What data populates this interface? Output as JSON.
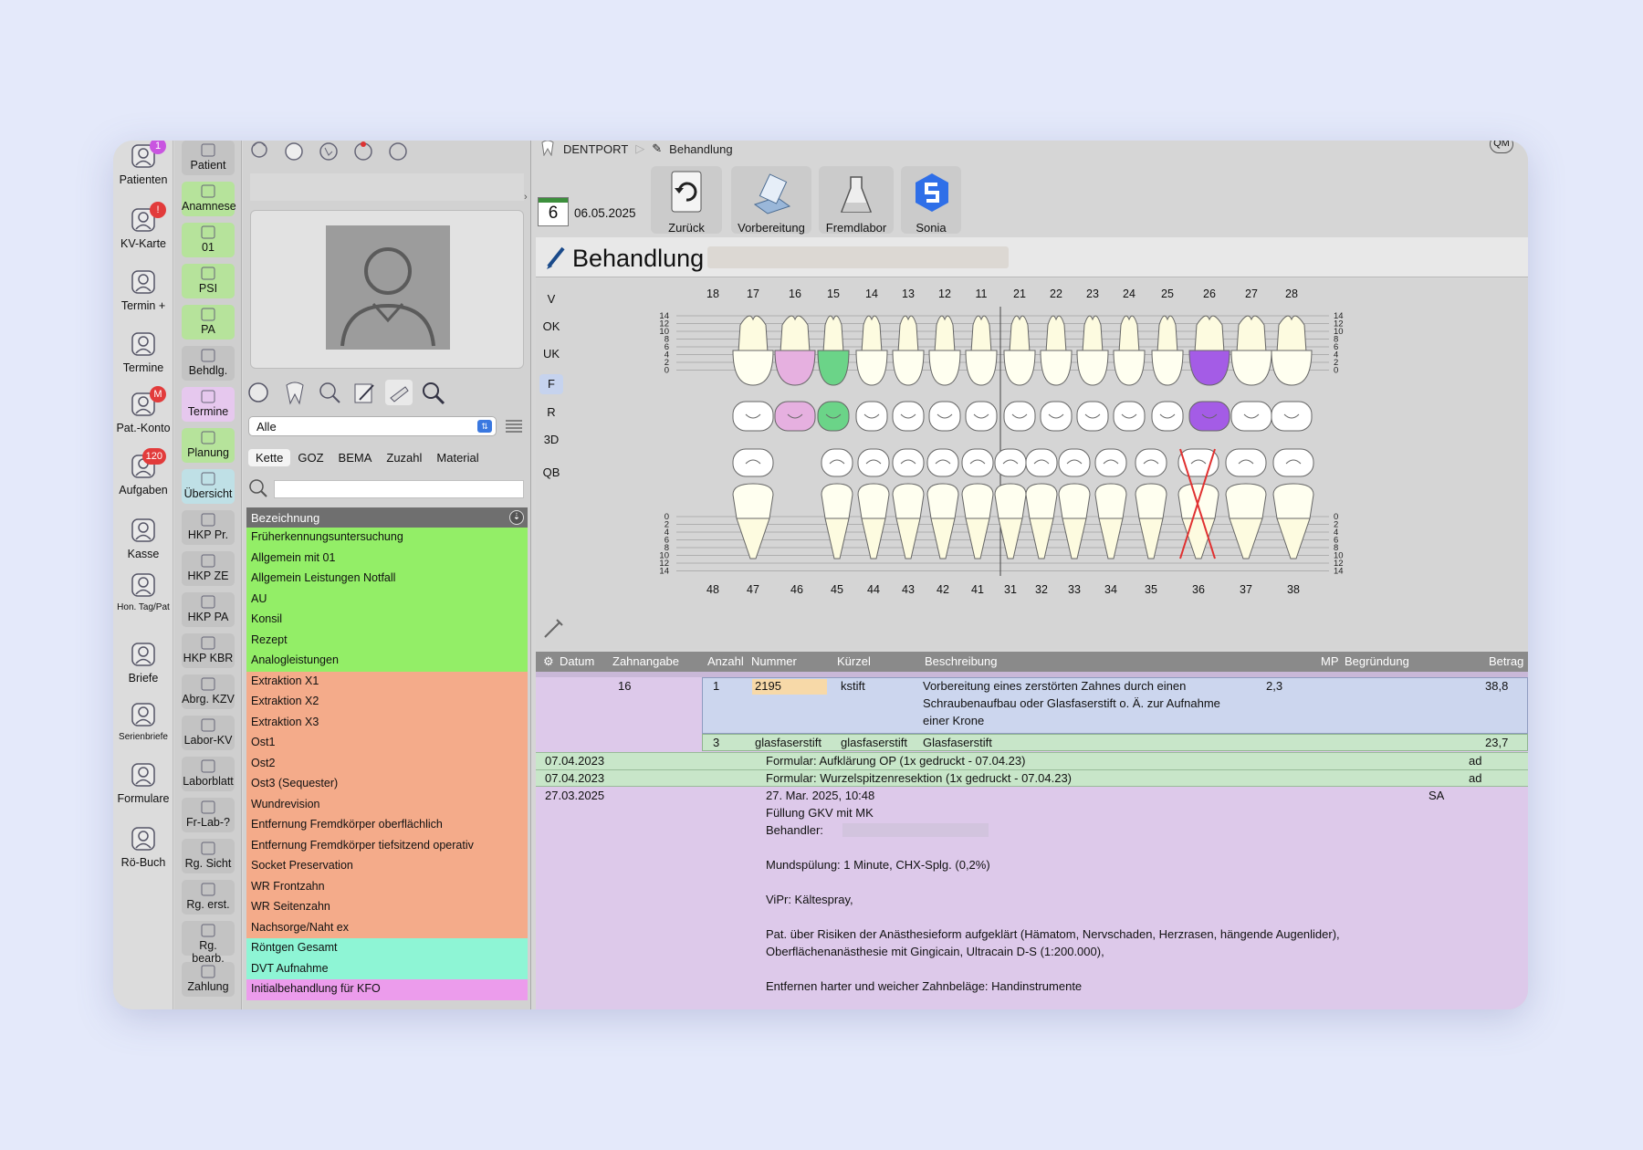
{
  "rail1": [
    {
      "label": "Patienten",
      "icon": "patients-icon",
      "badge": "1",
      "badge_color": "#c955e0"
    },
    {
      "label": "KV-Karte",
      "icon": "insurance-card-icon",
      "badge": "!",
      "badge_color": "#e23b3b"
    },
    {
      "label": "Termin +",
      "icon": "add-appointment-icon"
    },
    {
      "label": "Termine",
      "icon": "appointments-icon"
    },
    {
      "label": "Pat.-Konto",
      "icon": "patient-account-icon",
      "badge": "M",
      "badge_color": "#e23b3b"
    },
    {
      "label": "Aufgaben",
      "icon": "tasks-icon",
      "badge": "120",
      "badge_color": "#e23b3b"
    },
    {
      "label": "Kasse",
      "icon": "cash-icon"
    },
    {
      "label": "Hon. Tag/Pat",
      "icon": "fees-icon"
    },
    {
      "label": "Briefe",
      "icon": "letters-icon"
    },
    {
      "label": "Serienbriefe",
      "icon": "mail-merge-icon"
    },
    {
      "label": "Formulare",
      "icon": "forms-icon"
    },
    {
      "label": "Rö-Buch",
      "icon": "xray-book-icon"
    }
  ],
  "rail2": [
    {
      "label": "Patient",
      "color": "#c3c3c3"
    },
    {
      "label": "Anamnese",
      "color": "#b6e39b"
    },
    {
      "label": "01",
      "color": "#b6e39b"
    },
    {
      "label": "PSI",
      "color": "#b6e39b"
    },
    {
      "label": "PA",
      "color": "#b6e39b"
    },
    {
      "label": "Behdlg.",
      "color": "#c3c3c3"
    },
    {
      "label": "Termine",
      "color": "#e6c8ee"
    },
    {
      "label": "Planung",
      "color": "#b6e39b"
    },
    {
      "label": "Übersicht",
      "color": "#bfe0e6"
    },
    {
      "label": "HKP Pr.",
      "color": "#c3c3c3"
    },
    {
      "label": "HKP ZE",
      "color": "#c3c3c3"
    },
    {
      "label": "HKP PA",
      "color": "#c3c3c3"
    },
    {
      "label": "HKP KBR",
      "color": "#c3c3c3"
    },
    {
      "label": "Abrg. KZV",
      "color": "#c3c3c3"
    },
    {
      "label": "Labor-KV",
      "color": "#c3c3c3"
    },
    {
      "label": "Laborblatt",
      "color": "#c3c3c3"
    },
    {
      "label": "Fr-Lab-?",
      "color": "#c3c3c3"
    },
    {
      "label": "Rg. Sicht",
      "color": "#c3c3c3"
    },
    {
      "label": "Rg. erst.",
      "color": "#c3c3c3"
    },
    {
      "label": "Rg. bearb.",
      "color": "#c3c3c3"
    },
    {
      "label": "Zahlung",
      "color": "#c3c3c3"
    }
  ],
  "filter": {
    "select_value": "Alle",
    "tabs": [
      "Kette",
      "GOZ",
      "BEMA",
      "Zuzahl",
      "Material"
    ],
    "active_tab": "Kette",
    "search_value": "",
    "column_header": "Bezeichnung"
  },
  "services": [
    {
      "label": "Früherkennungsuntersuchung",
      "color": "#93ee67"
    },
    {
      "label": "Allgemein mit 01",
      "color": "#93ee67"
    },
    {
      "label": "Allgemein Leistungen Notfall",
      "color": "#93ee67"
    },
    {
      "label": "AU",
      "color": "#93ee67"
    },
    {
      "label": "Konsil",
      "color": "#93ee67"
    },
    {
      "label": "Rezept",
      "color": "#93ee67"
    },
    {
      "label": "Analogleistungen",
      "color": "#93ee67"
    },
    {
      "label": "Extraktion X1",
      "color": "#f4ab8a"
    },
    {
      "label": "Extraktion X2",
      "color": "#f4ab8a"
    },
    {
      "label": "Extraktion X3",
      "color": "#f4ab8a"
    },
    {
      "label": "Ost1",
      "color": "#f4ab8a"
    },
    {
      "label": "Ost2",
      "color": "#f4ab8a"
    },
    {
      "label": "Ost3 (Sequester)",
      "color": "#f4ab8a"
    },
    {
      "label": "Wundrevision",
      "color": "#f4ab8a"
    },
    {
      "label": "Entfernung Fremdkörper oberflächlich",
      "color": "#f4ab8a"
    },
    {
      "label": "Entfernung Fremdkörper tiefsitzend operativ",
      "color": "#f4ab8a"
    },
    {
      "label": "Socket Preservation",
      "color": "#f4ab8a"
    },
    {
      "label": "WR Frontzahn",
      "color": "#f4ab8a"
    },
    {
      "label": "WR Seitenzahn",
      "color": "#f4ab8a"
    },
    {
      "label": "Nachsorge/Naht ex",
      "color": "#f4ab8a"
    },
    {
      "label": "Röntgen Gesamt",
      "color": "#8ef5d5"
    },
    {
      "label": "DVT Aufnahme",
      "color": "#8ef5d5"
    },
    {
      "label": "Initialbehandlung für KFO",
      "color": "#ec9cec"
    }
  ],
  "breadcrumb": {
    "app": "DENTPORT",
    "page": "Behandlung"
  },
  "qm_label": "QM",
  "calendar_day": "6",
  "date": "06.05.2025",
  "toolbar": [
    {
      "label": "Zurück",
      "icon": "back-icon"
    },
    {
      "label": "Vorbereitung",
      "icon": "preparation-icon"
    },
    {
      "label": "Fremdlabor",
      "icon": "lab-flask-icon"
    },
    {
      "label": "Sonia",
      "icon": "sonia-icon"
    }
  ],
  "section_title": "Behandlung",
  "chart_keys": [
    "V",
    "OK",
    "UK",
    "F",
    "R",
    "3D",
    "QB"
  ],
  "upper_teeth": [
    "18",
    "17",
    "16",
    "15",
    "14",
    "13",
    "12",
    "11",
    "21",
    "22",
    "23",
    "24",
    "25",
    "26",
    "27",
    "28"
  ],
  "lower_teeth": [
    "48",
    "47",
    "46",
    "45",
    "44",
    "43",
    "42",
    "41",
    "31",
    "32",
    "33",
    "34",
    "35",
    "36",
    "37",
    "38"
  ],
  "scale_upper": [
    "14",
    "12",
    "10",
    "8",
    "6",
    "4",
    "2",
    "0"
  ],
  "scale_lower": [
    "0",
    "2",
    "4",
    "6",
    "8",
    "10",
    "12",
    "14"
  ],
  "tooth_status": {
    "16": "pink",
    "15": "green",
    "26": "purple",
    "18": "missing",
    "28": "present",
    "48": "missing",
    "36": "extracted"
  },
  "status_colors": {
    "pink": "#e6b0e0",
    "green": "#6bd488",
    "purple": "#a45ce6",
    "crown": "#fffff0",
    "cross": "#e03030"
  },
  "table": {
    "headers": [
      "Datum",
      "Zahnangabe",
      "Anzahl",
      "Nummer",
      "Kürzel",
      "Beschreibung",
      "MP",
      "Begründung",
      "Betrag"
    ],
    "row1": {
      "tooth": "16",
      "count": "1",
      "number": "2195",
      "short": "kstift",
      "desc1": "Vorbereitung eines zerstörten Zahnes durch einen",
      "desc2": "Schraubenaufbau oder Glasfaserstift o. Ä. zur Aufnahme",
      "desc3": "einer Krone",
      "mp": "2,3",
      "amount": "38,8"
    },
    "row2": {
      "count": "3",
      "number": "glasfaserstift",
      "short": "glasfaserstift",
      "desc": "Glasfaserstift",
      "amount": "23,7"
    },
    "row3": {
      "date": "07.04.2023",
      "desc": "Formular: Aufklärung OP (1x gedruckt - 07.04.23)",
      "by": "ad"
    },
    "row4": {
      "date": "07.04.2023",
      "desc": "Formular: Wurzelspitzenresektion (1x gedruckt - 07.04.23)",
      "by": "ad"
    },
    "row5": {
      "date": "27.03.2025",
      "by": "SA",
      "lines": [
        "27. Mar. 2025, 10:48",
        "Füllung GKV mit MK",
        "Behandler:",
        "",
        "Mundspülung: 1 Minute, CHX-Splg. (0,2%)",
        "",
        "ViPr: Kältespray,",
        "",
        "Pat. über Risiken der Anästhesieform aufgeklärt (Hämatom, Nervschaden, Herzrasen, hängende Augenlider),",
        "Oberflächenanästhesie mit Gingicain, Ultracain D-S (1:200.000),",
        "",
        "Entfernen harter und weicher Zahnbeläge: Handinstrumente"
      ]
    }
  }
}
